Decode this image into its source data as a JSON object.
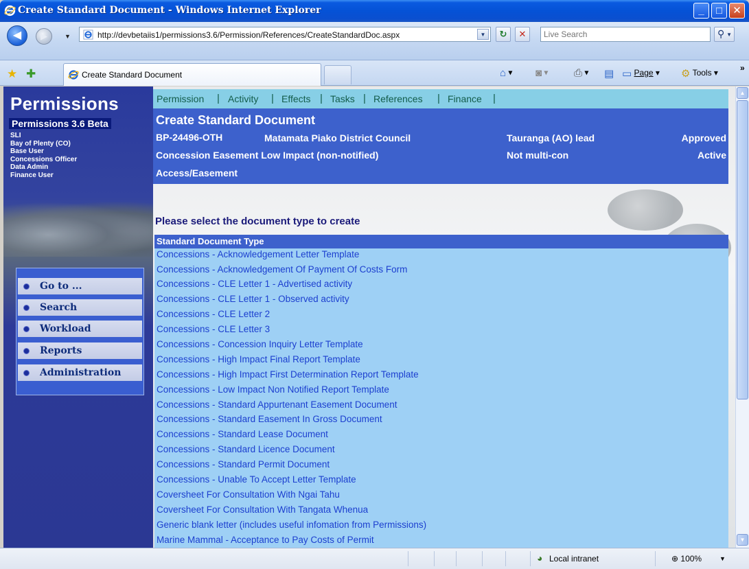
{
  "window": {
    "title": "Create Standard Document - Windows Internet Explorer",
    "minimize_glyph": "_",
    "maximize_glyph": "□",
    "close_glyph": "✕"
  },
  "address_bar": {
    "url": "http://devbetaiis1/permissions3.6/Permission/References/CreateStandardDoc.aspx",
    "search_placeholder": "Live Search",
    "back_glyph": "◀",
    "forward_glyph": "▶",
    "refresh_glyph": "↻",
    "stop_glyph": "✕"
  },
  "tab_bar": {
    "active_tab_label": "Create Standard Document",
    "commands": {
      "home_icon": "home-icon",
      "feeds_icon": "feeds-icon",
      "print_icon": "print-icon",
      "page_label": "Page",
      "tools_label": "Tools"
    }
  },
  "sidebar": {
    "brand": "Permissions",
    "version": "Permissions 3.6 Beta",
    "roles": [
      "SLI",
      "Bay of Plenty (CO)",
      "Base User",
      "Concessions Officer",
      "Data Admin",
      "Finance User"
    ],
    "menu": [
      {
        "label": "Go to ..."
      },
      {
        "label": "Search"
      },
      {
        "label": "Workload"
      },
      {
        "label": "Reports"
      },
      {
        "label": "Administration"
      }
    ]
  },
  "main_nav": {
    "links": [
      "Permission",
      "Activity",
      "Effects",
      "Tasks",
      "References",
      "Finance"
    ],
    "separator": "|"
  },
  "header": {
    "title": "Create Standard Document",
    "permission_id": "BP-24496-OTH",
    "applicant": "Matamata Piako District Council",
    "office": "Tauranga (AO) lead",
    "status": "Approved",
    "permission_type": "Concession Easement Low Impact (non-notified)",
    "multi_con": "Not multi-con",
    "state": "Active",
    "activity": "Access/Easement"
  },
  "documents": {
    "prompt": "Please select the document type to create",
    "column_header": "Standard Document Type",
    "items": [
      "Concessions - Acknowledgement Letter Template",
      "Concessions - Acknowledgement Of Payment Of Costs Form",
      "Concessions - CLE Letter 1 - Advertised activity",
      "Concessions - CLE Letter 1 - Observed activity",
      "Concessions - CLE Letter 2",
      "Concessions - CLE Letter 3",
      "Concessions - Concession Inquiry Letter Template",
      "Concessions - High Impact Final Report Template",
      "Concessions - High Impact First Determination Report Template",
      "Concessions - Low Impact Non Notified Report Template",
      "Concessions - Standard Appurtenant Easement Document",
      "Concessions - Standard Easement In Gross Document",
      "Concessions - Standard Lease Document",
      "Concessions - Standard Licence Document",
      "Concessions - Standard Permit Document",
      "Concessions - Unable To Accept Letter Template",
      "Coversheet For Consultation With Ngai Tahu",
      "Coversheet For Consultation With Tangata Whenua",
      "Generic blank letter (includes useful infomation from Permissions)",
      "Marine Mammal - Acceptance to Pay Costs of Permit"
    ]
  },
  "status_bar": {
    "zone": "Local intranet",
    "zoom": "100%"
  },
  "colors": {
    "sidebar_blue": "#2b3893",
    "header_blue": "#3d61cc",
    "nav_teal": "#87cfe6",
    "list_bg": "#9ed0f5",
    "link_blue": "#1c3fcf"
  }
}
